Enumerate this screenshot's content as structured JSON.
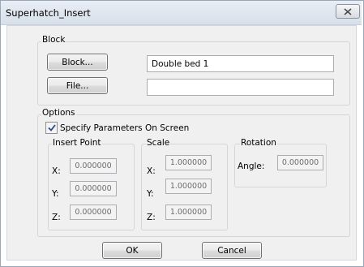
{
  "window": {
    "title": "Superhatch_Insert"
  },
  "block_group": {
    "label": "Block",
    "block_button": "Block...",
    "file_button": "File...",
    "block_value": "Double bed 1",
    "file_value": ""
  },
  "options_group": {
    "label": "Options",
    "specify_checkbox_label": "Specify Parameters On Screen",
    "specify_checked": true,
    "insert_point": {
      "label": "Insert Point",
      "x_label": "X:",
      "x_value": "0.000000",
      "y_label": "Y:",
      "y_value": "0.000000",
      "z_label": "Z:",
      "z_value": "0.000000"
    },
    "scale": {
      "label": "Scale",
      "x_label": "X:",
      "x_value": "1.000000",
      "y_label": "Y:",
      "y_value": "1.000000",
      "z_label": "Z:",
      "z_value": "1.000000"
    },
    "rotation": {
      "label": "Rotation",
      "angle_label": "Angle:",
      "angle_value": "0.000000"
    }
  },
  "buttons": {
    "ok": "OK",
    "cancel": "Cancel"
  },
  "icons": {
    "close": "close-icon",
    "check": "checkmark-icon"
  }
}
